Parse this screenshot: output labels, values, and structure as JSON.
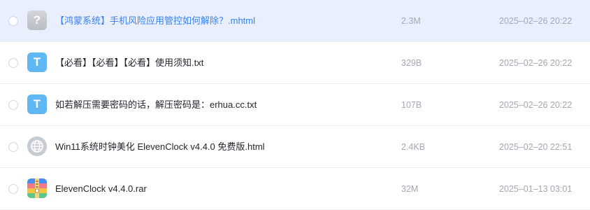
{
  "files": [
    {
      "icon": "question-mark-icon",
      "icon_glyph": "?",
      "name": "【鸿蒙系统】手机风险应用管控如何解除？.mhtml",
      "size": "2.3M",
      "date": "2025–02–26 20:22",
      "selected": true
    },
    {
      "icon": "txt-file-icon",
      "icon_glyph": "T",
      "name": "【必看】【必看】【必看】使用须知.txt",
      "size": "329B",
      "date": "2025–02–26 20:22",
      "selected": false
    },
    {
      "icon": "txt-file-icon",
      "icon_glyph": "T",
      "name": "如若解压需要密码的话，解压密码是：erhua.cc.txt",
      "size": "107B",
      "date": "2025–02–26 20:22",
      "selected": false
    },
    {
      "icon": "globe-html-icon",
      "icon_glyph": "",
      "name": "Win11系统时钟美化 ElevenClock v4.4.0 免费版.html",
      "size": "2.4KB",
      "date": "2025–02–20 22:51",
      "selected": false
    },
    {
      "icon": "rar-archive-icon",
      "icon_glyph": "",
      "name": "ElevenClock v4.4.0.rar",
      "size": "32M",
      "date": "2025–01–13 03:01",
      "selected": false
    }
  ],
  "colors": {
    "selected_row_bg": "#e9effd",
    "selected_text": "#3b82f0",
    "txt_icon": "#5fb8f3",
    "meta_text": "#a3a8b1"
  }
}
